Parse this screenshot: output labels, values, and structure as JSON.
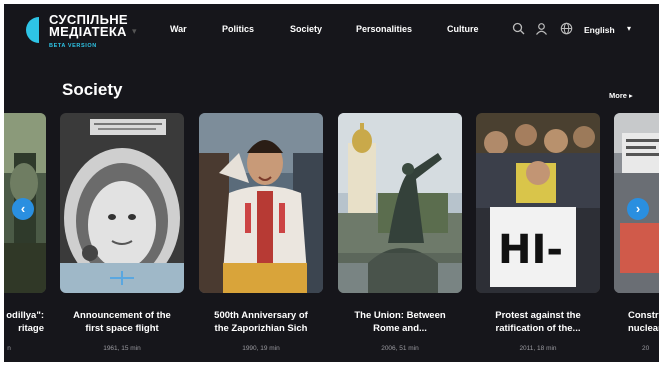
{
  "brand": {
    "line1": "СУСПІЛЬНЕ",
    "line2": "МЕДІАТЕКА",
    "beta": "BETA VERSION"
  },
  "nav": [
    "War",
    "Politics",
    "Society",
    "Personalities",
    "Culture"
  ],
  "language": "English",
  "section": {
    "title": "Society",
    "more": "More ▸"
  },
  "cards": [
    {
      "title_l1": "odillya\":",
      "title_l2": "ritage",
      "meta": "n"
    },
    {
      "title_l1": "Announcement of the",
      "title_l2": "first space flight",
      "meta": "1961, 15 min"
    },
    {
      "title_l1": "500th Anniversary of",
      "title_l2": "the Zaporizhian Sich",
      "meta": "1990, 19 min"
    },
    {
      "title_l1": "The Union: Between",
      "title_l2": "Rome and...",
      "meta": "2006, 51 min"
    },
    {
      "title_l1": "Protest against the",
      "title_l2": "ratification of the...",
      "meta": "2011, 18 min"
    },
    {
      "title_l1": "Constr",
      "title_l2": "nuclear v",
      "meta": "20"
    }
  ],
  "image_text": {
    "protest_sign": "НІ-",
    "sign_top_left": "",
    "sign_right": ""
  },
  "colors": {
    "background": "#16161b",
    "accent": "#2a8fe0",
    "brand_cyan": "#2ec4e6"
  }
}
